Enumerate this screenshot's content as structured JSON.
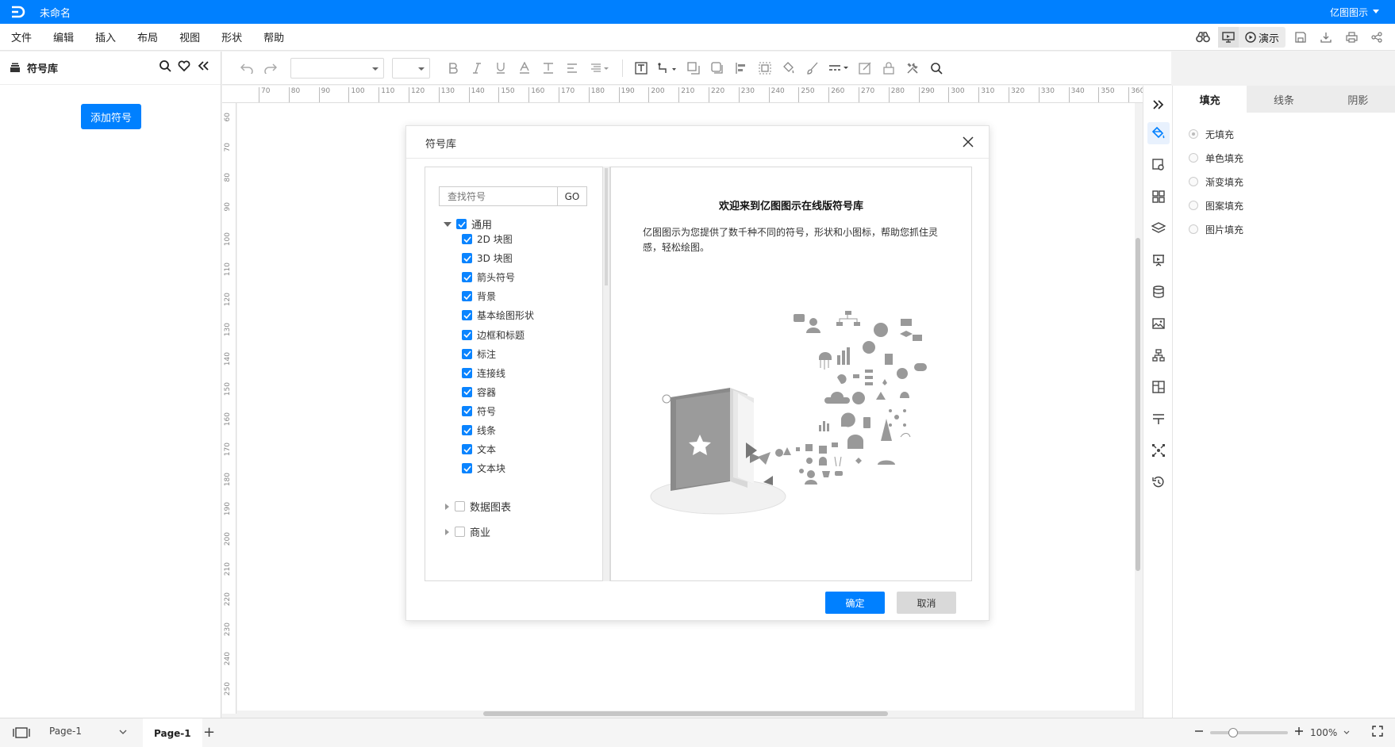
{
  "app": {
    "doc_title": "未命名",
    "brand": "亿图图示"
  },
  "menu": [
    "文件",
    "编辑",
    "插入",
    "布局",
    "视图",
    "形状",
    "帮助"
  ],
  "menubar_right": {
    "present_label": "演示"
  },
  "left_panel": {
    "title": "符号库",
    "add_button": "添加符号"
  },
  "ruler": {
    "h_ticks": [
      "70",
      "80",
      "90",
      "100",
      "110",
      "120",
      "130",
      "140",
      "150",
      "160",
      "170",
      "180",
      "190",
      "200",
      "210",
      "220",
      "230",
      "240",
      "250",
      "260",
      "270",
      "280",
      "290",
      "300",
      "310",
      "320",
      "330",
      "340",
      "350",
      "360"
    ],
    "v_ticks": [
      "60",
      "70",
      "80",
      "90",
      "100",
      "110",
      "120",
      "130",
      "140",
      "150",
      "160",
      "170",
      "180",
      "190",
      "200",
      "210",
      "220",
      "230",
      "240",
      "250"
    ]
  },
  "right_panel": {
    "tabs": [
      "填充",
      "线条",
      "阴影"
    ],
    "fill_options": [
      "无填充",
      "单色填充",
      "渐变填充",
      "图案填充",
      "图片填充"
    ]
  },
  "bottom": {
    "page_select": "Page-1",
    "page_tab": "Page-1",
    "zoom": "100%",
    "zoom_fraction": 0.3
  },
  "dialog": {
    "title": "符号库",
    "search_placeholder": "查找符号",
    "search_go": "GO",
    "root_category": "通用",
    "subcategories": [
      "2D 块图",
      "3D 块图",
      "箭头符号",
      "背景",
      "基本绘图形状",
      "边框和标题",
      "标注",
      "连接线",
      "容器",
      "符号",
      "线条",
      "文本",
      "文本块"
    ],
    "collapsed_categories": [
      "数据图表",
      "商业"
    ],
    "welcome_title": "欢迎来到亿图图示在线版符号库",
    "welcome_desc": "亿图图示为您提供了数千种不同的符号，形状和小图标，帮助您抓住灵感，轻松绘图。",
    "ok": "确定",
    "cancel": "取消"
  },
  "colors": {
    "accent": "#0080ff",
    "checkbox": "#0a84ff"
  }
}
